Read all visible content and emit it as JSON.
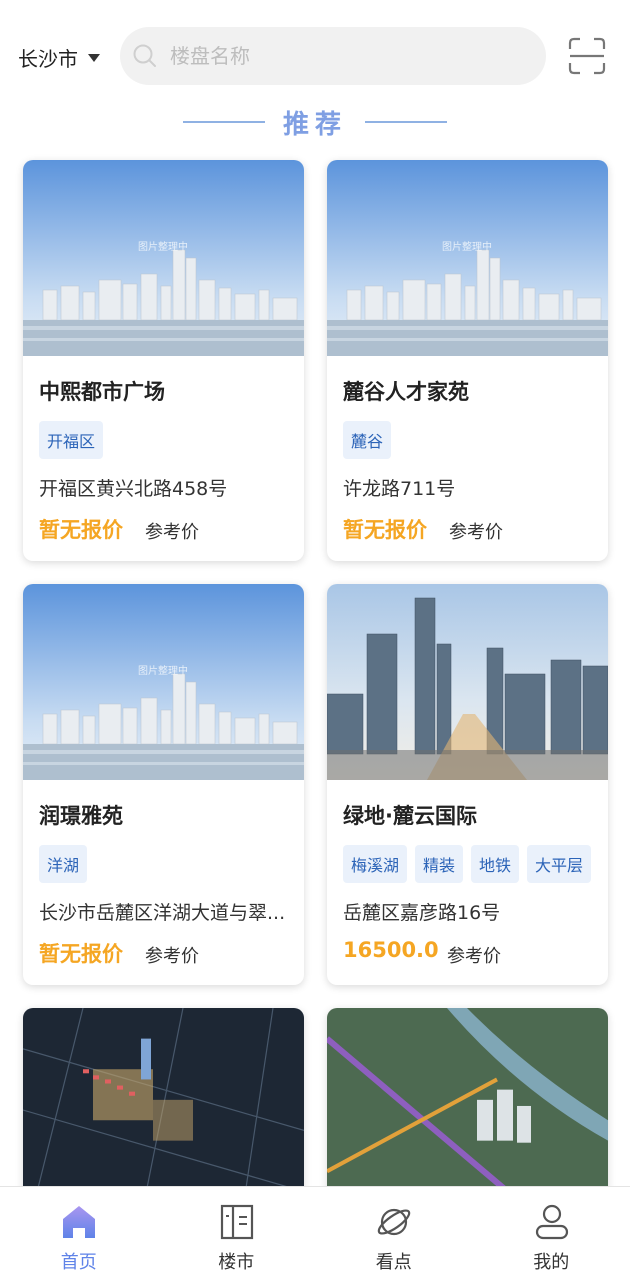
{
  "header": {
    "city": "长沙市",
    "search_placeholder": "楼盘名称"
  },
  "section": {
    "title": "推荐"
  },
  "listings": [
    {
      "name": "中熙都市广场",
      "tags": [
        "开福区"
      ],
      "address": "开福区黄兴北路458号",
      "price": "暂无报价",
      "price_label": "参考价",
      "image_watermark": "图片整理中"
    },
    {
      "name": "麓谷人才家苑",
      "tags": [
        "麓谷"
      ],
      "address": "许龙路711号",
      "price": "暂无报价",
      "price_label": "参考价",
      "image_watermark": "图片整理中"
    },
    {
      "name": "润璟雅苑",
      "tags": [
        "洋湖"
      ],
      "address": "长沙市岳麓区洋湖大道与翠...",
      "price": "暂无报价",
      "price_label": "参考价",
      "image_watermark": "图片整理中"
    },
    {
      "name": "绿地·麓云国际",
      "tags": [
        "梅溪湖",
        "精装",
        "地铁",
        "大平层"
      ],
      "address": "岳麓区嘉彦路16号",
      "price": "16500.0",
      "price_label": "参考价"
    }
  ],
  "bottom_nav": [
    {
      "label": "首页",
      "icon": "home-icon",
      "active": true
    },
    {
      "label": "楼市",
      "icon": "building-icon",
      "active": false
    },
    {
      "label": "看点",
      "icon": "planet-icon",
      "active": false
    },
    {
      "label": "我的",
      "icon": "user-icon",
      "active": false
    }
  ],
  "colors": {
    "accent": "#5f83e8",
    "price": "#f5a623",
    "tag_bg": "#eaf1fb",
    "tag_text": "#2c64b8"
  }
}
